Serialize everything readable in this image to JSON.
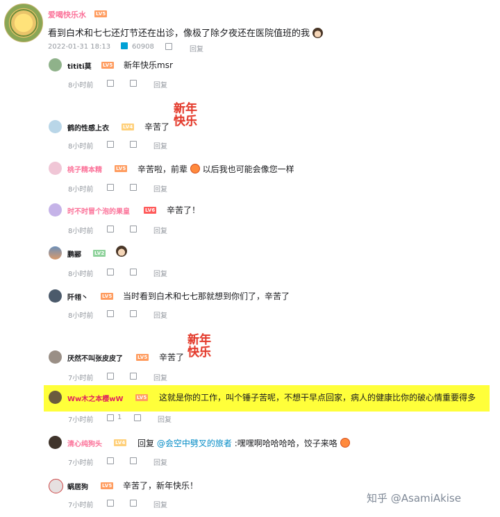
{
  "main": {
    "username": "爱喝快乐水",
    "level": "LV5",
    "text": "看到白术和七七还灯节还在出诊，像极了除夕夜还在医院值班的我",
    "time": "2022-01-31 18:13",
    "likes": "60908",
    "reply_label": "回复"
  },
  "replies": [
    {
      "name": "tititi莫",
      "level": "LV5",
      "text": "新年快乐msr",
      "time": "8小时前",
      "likes": "",
      "reply": "回复"
    },
    {
      "name": "鹤的性感上衣",
      "level": "LV4",
      "text": "辛苦了",
      "sticker": "新年快乐",
      "time": "8小时前",
      "likes": "",
      "reply": "回复"
    },
    {
      "name": "桃子精本精",
      "level": "LV5",
      "text_a": "辛苦啦，前辈",
      "text_b": "以后我也可能会像您一样",
      "time": "8小时前",
      "likes": "",
      "reply": "回复"
    },
    {
      "name": "时不时冒个泡的果皇",
      "level": "LV6",
      "text": "辛苦了！",
      "time": "8小时前",
      "likes": "",
      "reply": "回复"
    },
    {
      "name": "鹏郦",
      "level": "LV2",
      "text": "",
      "time": "8小时前",
      "likes": "",
      "reply": "回复"
    },
    {
      "name": "阡翎丶",
      "level": "LV5",
      "text": "当时看到白术和七七那就想到你们了，辛苦了",
      "time": "8小时前",
      "likes": "",
      "reply": "回复"
    },
    {
      "name": "厌然不叫张皮皮了",
      "level": "LV5",
      "text": "辛苦了",
      "sticker": "新年快乐",
      "time": "7小时前",
      "likes": "",
      "reply": "回复"
    },
    {
      "name": "Ww木之本樱wW",
      "level": "LV5",
      "text": "这就是你的工作，叫个锤子苦呢，不想干早点回家，病人的健康比你的破心情重要得多",
      "time": "7小时前",
      "likes": "1",
      "reply": "回复"
    },
    {
      "name": "清心纯狗头",
      "level": "LV4",
      "reply_prefix": "回复",
      "mention": "@会空中劈叉的旅者",
      "text": ":嘿嘿啊哈哈哈哈，饺子来咯",
      "time": "7小时前",
      "likes": "",
      "reply": "回复"
    },
    {
      "name": "蜗居狗",
      "level": "LV5",
      "text": "辛苦了，新年快乐！",
      "time": "7小时前",
      "likes": "",
      "reply": "回复"
    }
  ],
  "watermark": "知乎 @AsamiAkise",
  "colors": {
    "vip_name": "#fb7299",
    "meta": "#9499a0",
    "mention": "#008ac5",
    "highlight": "#ffff3a",
    "sticker": "#e33b2e"
  }
}
